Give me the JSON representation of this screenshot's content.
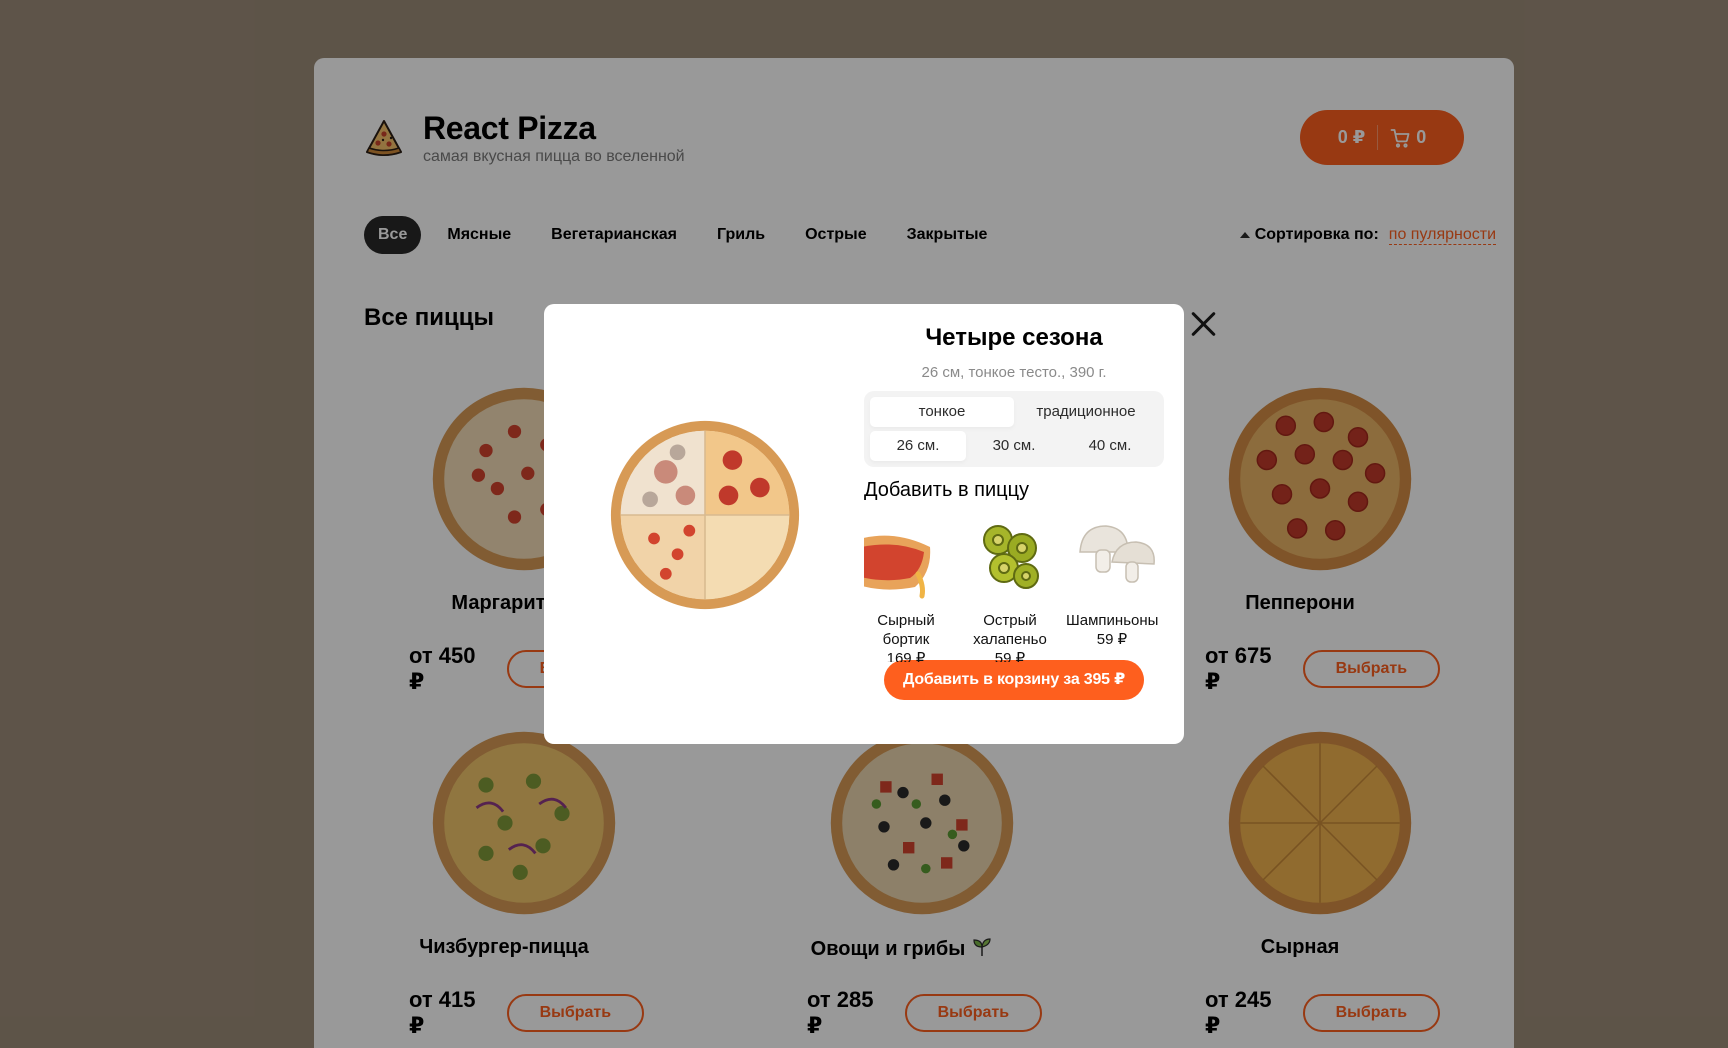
{
  "header": {
    "logo_title": "React Pizza",
    "logo_subtitle": "самая вкусная пицца во вселенной",
    "cart_total": "0 ₽",
    "cart_count": "0"
  },
  "categories": [
    "Все",
    "Мясные",
    "Вегетарианская",
    "Гриль",
    "Острые",
    "Закрытые"
  ],
  "active_category": "Все",
  "sort": {
    "label": "Сортировка по:",
    "value": "по пулярности"
  },
  "section_title": "Все пиццы",
  "pizzas": [
    {
      "name": "Маргарита",
      "price": "от 450 ₽",
      "button": "Выбрать"
    },
    {
      "name": "Пепперони",
      "price": "от 675 ₽",
      "button": "Выбрать"
    },
    {
      "name": "Чизбургер-пицца",
      "price": "от 415 ₽",
      "button": "Выбрать"
    },
    {
      "name": "Овощи и грибы",
      "price": "от 285 ₽",
      "button": "Выбрать"
    },
    {
      "name": "Сырная",
      "price": "от 245 ₽",
      "button": "Выбрать"
    }
  ],
  "modal": {
    "title": "Четыре сезона",
    "description": "26 см, тонкое тесто., 390 г.",
    "dough_types": [
      "тонкое",
      "традиционное"
    ],
    "selected_dough": "тонкое",
    "sizes": [
      "26 см.",
      "30 см.",
      "40 см."
    ],
    "selected_size": "26 см.",
    "add_title": "Добавить в пиццу",
    "toppings": [
      {
        "name": "Сырный бортик",
        "price": "169 ₽"
      },
      {
        "name": "Острый халапеньо",
        "price": "59 ₽"
      },
      {
        "name": "Шампиньоны",
        "price": "59 ₽"
      }
    ],
    "add_button": "Добавить в корзину за 395 ₽"
  },
  "colors": {
    "accent": "#fe5f1e",
    "page_bg": "#9c8c79"
  },
  "icons": [
    "pizza-logo-icon",
    "cart-icon",
    "sort-arrow-icon",
    "close-icon",
    "leaf-icon"
  ]
}
